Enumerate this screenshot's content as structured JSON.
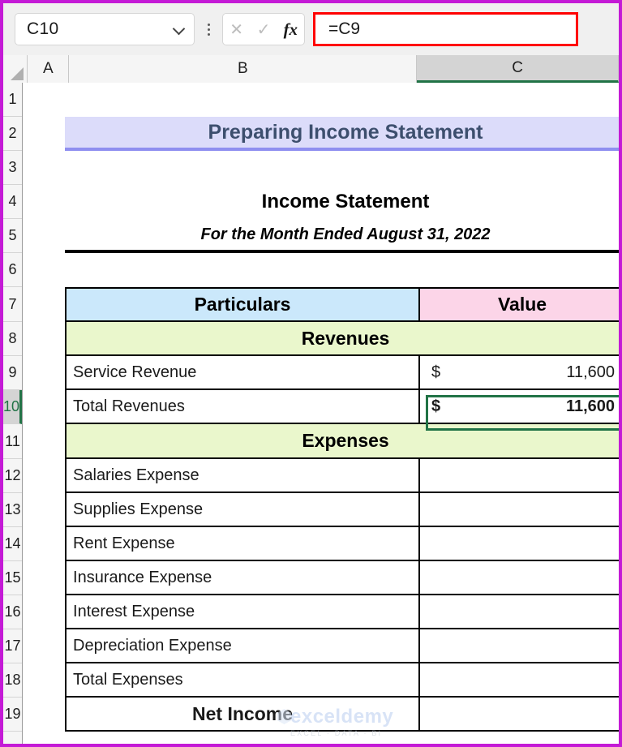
{
  "formula_bar": {
    "name_box_value": "C10",
    "cancel_icon": "close-icon",
    "confirm_icon": "check-icon",
    "function_icon": "fx",
    "formula_value": "=C9",
    "highlight_color": "#ff0000"
  },
  "columns": [
    {
      "label": "A",
      "selected": false
    },
    {
      "label": "B",
      "selected": false
    },
    {
      "label": "C",
      "selected": true
    }
  ],
  "rows": [
    {
      "label": "1",
      "selected": false
    },
    {
      "label": "2",
      "selected": false
    },
    {
      "label": "3",
      "selected": false
    },
    {
      "label": "4",
      "selected": false
    },
    {
      "label": "5",
      "selected": false
    },
    {
      "label": "6",
      "selected": false
    },
    {
      "label": "7",
      "selected": false
    },
    {
      "label": "8",
      "selected": false
    },
    {
      "label": "9",
      "selected": false
    },
    {
      "label": "10",
      "selected": true
    },
    {
      "label": "11",
      "selected": false
    },
    {
      "label": "12",
      "selected": false
    },
    {
      "label": "13",
      "selected": false
    },
    {
      "label": "14",
      "selected": false
    },
    {
      "label": "15",
      "selected": false
    },
    {
      "label": "16",
      "selected": false
    },
    {
      "label": "17",
      "selected": false
    },
    {
      "label": "18",
      "selected": false
    },
    {
      "label": "19",
      "selected": false
    }
  ],
  "sheet": {
    "banner_title": "Preparing Income Statement",
    "statement_title": "Income Statement",
    "statement_subtitle": "For the Month Ended August 31, 2022",
    "header_particulars": "Particulars",
    "header_value": "Value",
    "section_revenues": "Revenues",
    "section_expenses": "Expenses",
    "rows": {
      "service_revenue": {
        "label": "Service Revenue",
        "symbol": "$",
        "amount": "11,600"
      },
      "total_revenues": {
        "label": "Total Revenues",
        "symbol": "$",
        "amount": "11,600"
      },
      "salaries_expense": {
        "label": "Salaries Expense",
        "symbol": "",
        "amount": ""
      },
      "supplies_expense": {
        "label": "Supplies Expense",
        "symbol": "",
        "amount": ""
      },
      "rent_expense": {
        "label": "Rent Expense",
        "symbol": "",
        "amount": ""
      },
      "insurance_expense": {
        "label": "Insurance Expense",
        "symbol": "",
        "amount": ""
      },
      "interest_expense": {
        "label": "Interest Expense",
        "symbol": "",
        "amount": ""
      },
      "depreciation_expense": {
        "label": "Depreciation Expense",
        "symbol": "",
        "amount": ""
      },
      "total_expenses": {
        "label": "Total Expenses",
        "symbol": "",
        "amount": ""
      },
      "net_income": {
        "label": "Net Income",
        "symbol": "",
        "amount": ""
      }
    }
  },
  "watermark": {
    "main": "exceldemy",
    "sub": "EXCEL · DATA · BI"
  },
  "theme": {
    "banner_bg": "#dcdcfa",
    "banner_border": "#8f8ff0",
    "banner_text": "#3d4f6e",
    "particulars_bg": "#cbe8fb",
    "value_bg": "#fcd5e8",
    "section_bg": "#eaf7cc",
    "selection_green": "#217346",
    "window_border": "#c41ad6"
  }
}
